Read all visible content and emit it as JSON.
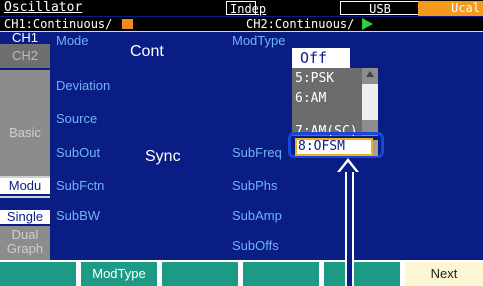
{
  "header": {
    "title": "Oscillator",
    "mode": "Indep",
    "interface": "USB",
    "cal_status": "Ucal"
  },
  "status": {
    "ch1": "CH1:Continuous/",
    "ch2": "CH2:Continuous/",
    "ch1_indicator_color": "#f08a20",
    "ch2_indicator_color": "#2ecc40"
  },
  "tabs": {
    "ch1": "CH1",
    "ch2": "CH2",
    "basic": "Basic",
    "modu": "Modu",
    "single": "Single",
    "dual_line1": "Dual",
    "dual_line2": "Graph"
  },
  "params": {
    "mode_label": "Mode",
    "mode_value": "Cont",
    "deviation_label": "Deviation",
    "source_label": "Source",
    "subout_label": "SubOut",
    "subout_value": "Sync",
    "subfctn_label": "SubFctn",
    "subbw_label": "SubBW",
    "modtype_label": "ModType",
    "subfreq_label": "SubFreq",
    "subphs_label": "SubPhs",
    "subamp_label": "SubAmp",
    "suboffs_label": "SubOffs"
  },
  "dropdown": {
    "current": "Off",
    "items": [
      "5:PSK",
      "6:AM",
      "7:AM(SC)"
    ],
    "selected": "8:OFSM"
  },
  "softkeys": [
    "",
    "ModType",
    "",
    "",
    "",
    "Next"
  ],
  "colors": {
    "screen_bg": "#0a1d85",
    "label_blue": "#6fb4f5",
    "softkey_teal": "#1d9a86",
    "accent_orange": "#f59a1c"
  }
}
